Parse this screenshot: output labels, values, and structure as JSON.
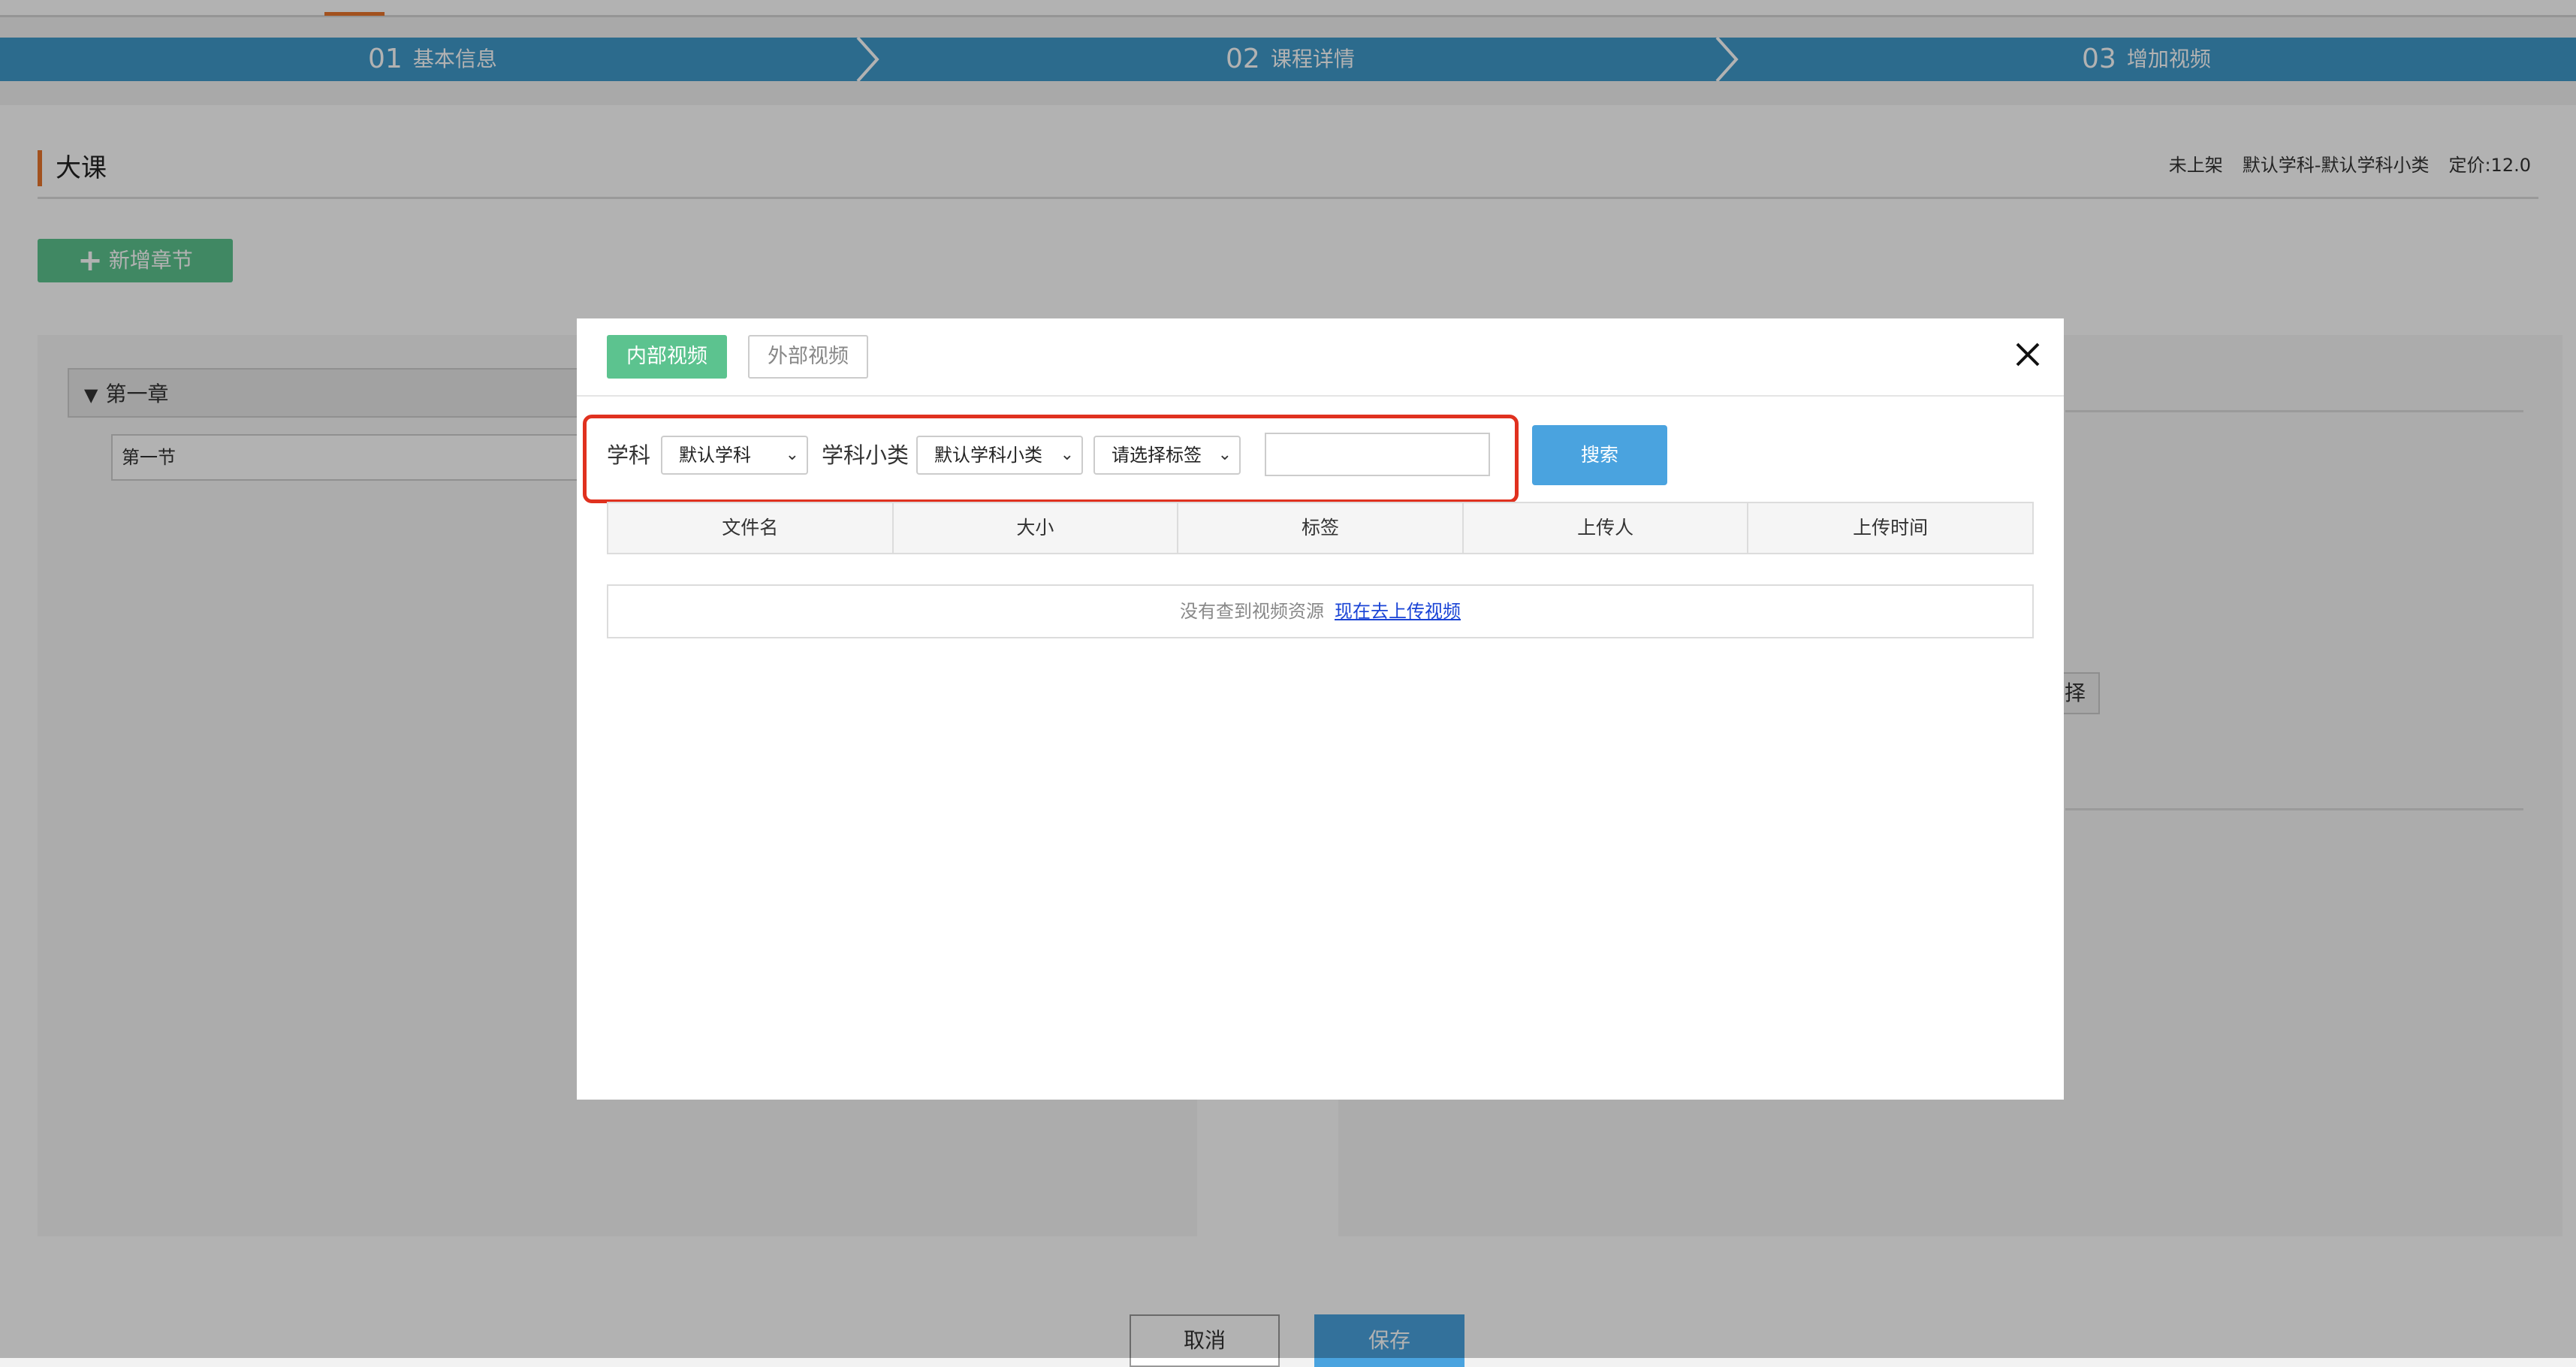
{
  "steps": [
    {
      "num": "01",
      "label": "基本信息"
    },
    {
      "num": "02",
      "label": "课程详情"
    },
    {
      "num": "03",
      "label": "增加视频"
    }
  ],
  "course": {
    "title": "大课",
    "status": "未上架",
    "category": "默认学科-默认学科小类",
    "price": "定价:12.0"
  },
  "add_chapter_label": "新增章节",
  "tree": {
    "chapter": "第一章",
    "section": "第一节"
  },
  "right_panel_button": "择",
  "footer": {
    "cancel": "取消",
    "save": "保存"
  },
  "modal": {
    "tab_internal": "内部视频",
    "tab_external": "外部视频",
    "filters": {
      "subject_label": "学科",
      "subject_value": "默认学科",
      "subcategory_label": "学科小类",
      "subcategory_value": "默认学科小类",
      "tag_value": "请选择标签",
      "search_value": ""
    },
    "search_button": "搜索",
    "table": {
      "headers": [
        "文件名",
        "大小",
        "标签",
        "上传人",
        "上传时间"
      ],
      "empty_text": "没有查到视频资源",
      "upload_link": "现在去上传视频"
    }
  },
  "colors": {
    "step_bar": "#3f9acb",
    "accent_orange": "#e9742b",
    "green": "#5cc38f",
    "blue_button": "#4aa3df",
    "highlight_red": "#e0311f",
    "link": "#1a44d6"
  }
}
